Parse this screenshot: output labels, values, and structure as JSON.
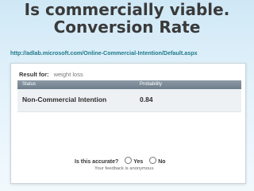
{
  "slide": {
    "title_line1": "Is commercially viable.",
    "title_line2": "Conversion Rate",
    "url": "http://adlab.microsoft.com/Online-Commercial-Intention/Default.aspx"
  },
  "panel": {
    "result_label": "Result for:",
    "query": "weight loss",
    "columns": [
      "Status",
      "Probability"
    ],
    "row": {
      "status": "Non-Commercial Intention",
      "probability": "0.84"
    },
    "accuracy_question": "Is this accurate?",
    "options": [
      "Yes",
      "No"
    ],
    "feedback_note": "Your feedback is anonymous."
  }
}
